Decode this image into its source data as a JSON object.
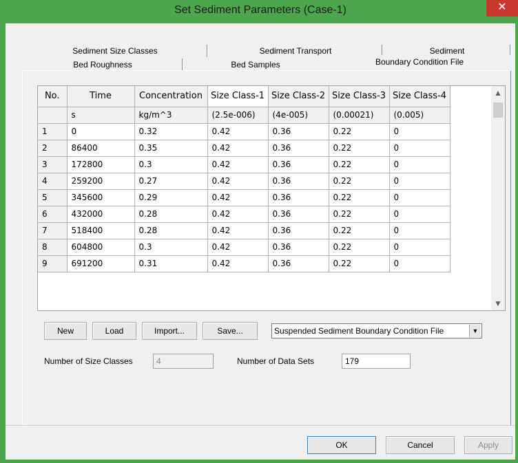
{
  "window": {
    "title": "Set Sediment Parameters (Case-1)",
    "close_glyph": "✕"
  },
  "tabs": {
    "row_back": [
      {
        "label": "Sediment Size Classes"
      },
      {
        "label": "Sediment Transport"
      },
      {
        "label": "Sediment"
      }
    ],
    "row_front": [
      {
        "label": "Bed Roughness"
      },
      {
        "label": "Bed Samples"
      },
      {
        "label": "Boundary Condition File"
      }
    ]
  },
  "grid": {
    "headers": [
      "No.",
      "Time",
      "Concentration",
      "Size Class-1",
      "Size Class-2",
      "Size Class-3",
      "Size Class-4"
    ],
    "units": [
      "",
      "s",
      "kg/m^3",
      "(2.5e-006)",
      "(4e-005)",
      "(0.00021)",
      "(0.005)"
    ],
    "rows": [
      [
        "1",
        "0",
        "0.32",
        "0.42",
        "0.36",
        "0.22",
        "0"
      ],
      [
        "2",
        "86400",
        "0.35",
        "0.42",
        "0.36",
        "0.22",
        "0"
      ],
      [
        "3",
        "172800",
        "0.3",
        "0.42",
        "0.36",
        "0.22",
        "0"
      ],
      [
        "4",
        "259200",
        "0.27",
        "0.42",
        "0.36",
        "0.22",
        "0"
      ],
      [
        "5",
        "345600",
        "0.29",
        "0.42",
        "0.36",
        "0.22",
        "0"
      ],
      [
        "6",
        "432000",
        "0.28",
        "0.42",
        "0.36",
        "0.22",
        "0"
      ],
      [
        "7",
        "518400",
        "0.28",
        "0.42",
        "0.36",
        "0.22",
        "0"
      ],
      [
        "8",
        "604800",
        "0.3",
        "0.42",
        "0.36",
        "0.22",
        "0"
      ],
      [
        "9",
        "691200",
        "0.31",
        "0.42",
        "0.36",
        "0.22",
        "0"
      ]
    ],
    "scroll_up_glyph": "▲",
    "scroll_down_glyph": "▼"
  },
  "file_buttons": {
    "new": "New",
    "load": "Load",
    "import": "Import...",
    "save": "Save..."
  },
  "file_type_select": {
    "value": "Suspended Sediment Boundary Condition File",
    "arrow_glyph": "▼"
  },
  "fields": {
    "size_classes_label": "Number of Size Classes",
    "size_classes_value": "4",
    "data_sets_label": "Number of Data Sets",
    "data_sets_value": "179"
  },
  "dialog_buttons": {
    "ok": "OK",
    "cancel": "Cancel",
    "apply": "Apply"
  },
  "colors": {
    "title_bar": "#4ca64c",
    "close_button": "#c7372f",
    "dialog_background": "#f0f0f0"
  }
}
